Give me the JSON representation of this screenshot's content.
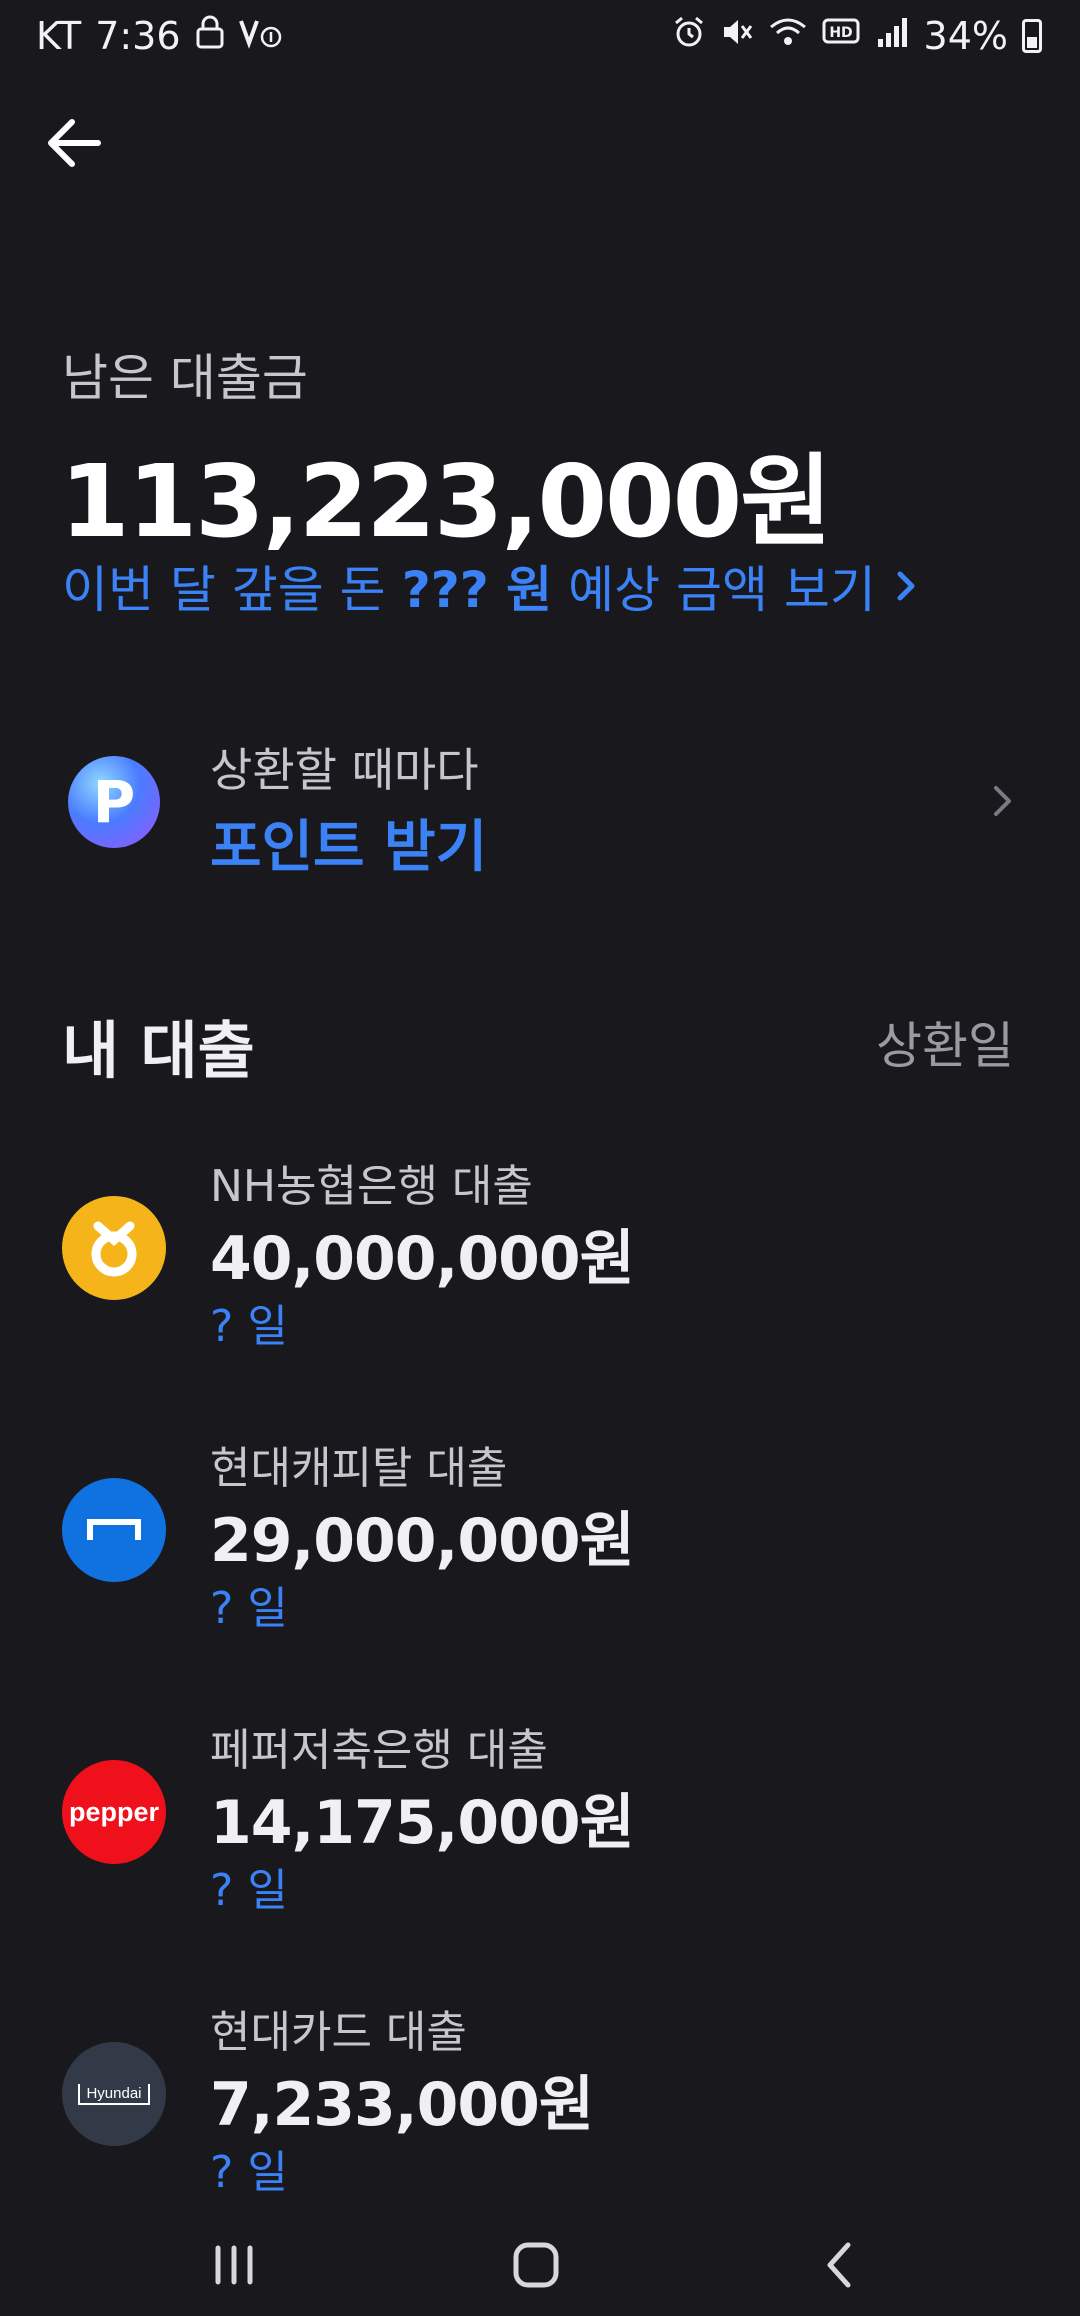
{
  "status_bar": {
    "carrier": "KT",
    "time": "7:36",
    "battery": "34%"
  },
  "header": {
    "back_icon": "arrow-left-icon"
  },
  "summary": {
    "label": "남은 대출금",
    "amount": "113,223,000원",
    "estimate_prefix": "이번 달 갚을 돈",
    "estimate_value": "??? 원",
    "estimate_suffix": "예상 금액 보기"
  },
  "points": {
    "icon_letter": "P",
    "subtitle": "상환할 때마다",
    "title": "포인트 받기"
  },
  "loans_section": {
    "title": "내 대출",
    "sort_label": "상환일"
  },
  "loans": [
    {
      "name": "NH농협은행 대출",
      "amount": "40,000,000원",
      "day": "? 일",
      "logo_color": "#f6b41b",
      "logo": "nh-logo"
    },
    {
      "name": "현대캐피탈 대출",
      "amount": "29,000,000원",
      "day": "? 일",
      "logo_color": "#0f72e0",
      "logo": "hyundai-capital-logo"
    },
    {
      "name": "페퍼저축은행 대출",
      "amount": "14,175,000원",
      "day": "? 일",
      "logo_color": "#f0101c",
      "logo": "pepper-logo",
      "logo_text": "pepper"
    },
    {
      "name": "현대카드 대출",
      "amount": "7,233,000원",
      "day": "? 일",
      "logo_color": "#333a47",
      "logo": "hyundai-card-logo",
      "logo_text": "Hyundai"
    }
  ],
  "accent_color": "#3b82f6",
  "background_color": "#18181d"
}
